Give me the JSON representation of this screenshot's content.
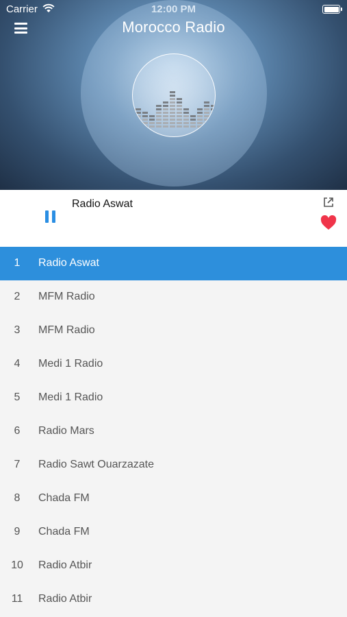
{
  "status_bar": {
    "carrier": "Carrier",
    "time": "12:00 PM"
  },
  "header": {
    "title": "Morocco Radio",
    "menu_icon": "hamburger-menu-icon"
  },
  "player": {
    "now_playing": "Radio Aswat",
    "state": "playing",
    "pause_icon": "pause-icon",
    "share_icon": "share-external-icon",
    "favorite_icon": "heart-icon",
    "accent_color": "#2d8fdc",
    "favorite_color": "#f0344a"
  },
  "stations": [
    {
      "number": "1",
      "name": "Radio Aswat",
      "active": true
    },
    {
      "number": "2",
      "name": "MFM Radio"
    },
    {
      "number": "3",
      "name": "MFM Radio"
    },
    {
      "number": "4",
      "name": "Medi 1 Radio"
    },
    {
      "number": "5",
      "name": "Medi 1 Radio"
    },
    {
      "number": "6",
      "name": "Radio Mars"
    },
    {
      "number": "7",
      "name": "Radio Sawt Ouarzazate"
    },
    {
      "number": "8",
      "name": "Chada FM"
    },
    {
      "number": "9",
      "name": "Chada FM"
    },
    {
      "number": "10",
      "name": "Radio Atbir"
    },
    {
      "number": "11",
      "name": "Radio Atbir"
    }
  ]
}
